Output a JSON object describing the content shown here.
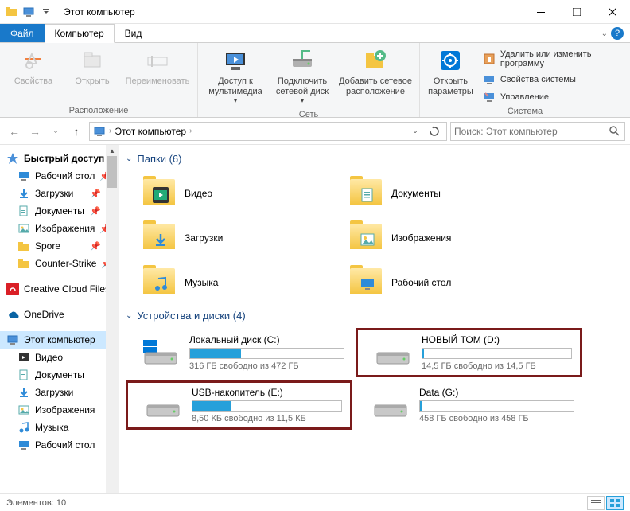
{
  "window": {
    "title": "Этот компьютер"
  },
  "tabs": {
    "file": "Файл",
    "computer": "Компьютер",
    "view": "Вид"
  },
  "ribbon": {
    "location": {
      "group": "Расположение",
      "properties": "Свойства",
      "open": "Открыть",
      "rename": "Переименовать"
    },
    "network": {
      "group": "Сеть",
      "media": "Доступ к мультимедиа",
      "map_drive": "Подключить сетевой диск",
      "add_location": "Добавить сетевое расположение"
    },
    "system": {
      "group": "Система",
      "open_settings": "Открыть параметры",
      "uninstall": "Удалить или изменить программу",
      "sys_props": "Свойства системы",
      "manage": "Управление"
    }
  },
  "nav": {
    "breadcrumb": "Этот компьютер",
    "search_placeholder": "Поиск: Этот компьютер"
  },
  "sidebar": {
    "quick_access": "Быстрый доступ",
    "items_qa": [
      {
        "label": "Рабочий стол",
        "icon": "desktop",
        "pinned": true
      },
      {
        "label": "Загрузки",
        "icon": "downloads",
        "pinned": true
      },
      {
        "label": "Документы",
        "icon": "documents",
        "pinned": true
      },
      {
        "label": "Изображения",
        "icon": "pictures",
        "pinned": true
      },
      {
        "label": "Spore",
        "icon": "folder",
        "pinned": true
      },
      {
        "label": "Counter-Strike",
        "icon": "folder",
        "pinned": true
      }
    ],
    "creative": "Creative Cloud Files",
    "onedrive": "OneDrive",
    "this_pc": "Этот компьютер",
    "items_pc": [
      {
        "label": "Видео",
        "icon": "video"
      },
      {
        "label": "Документы",
        "icon": "documents"
      },
      {
        "label": "Загрузки",
        "icon": "downloads"
      },
      {
        "label": "Изображения",
        "icon": "pictures"
      },
      {
        "label": "Музыка",
        "icon": "music"
      },
      {
        "label": "Рабочий стол",
        "icon": "desktop"
      }
    ]
  },
  "content": {
    "folders_header": "Папки (6)",
    "devices_header": "Устройства и диски (4)",
    "folders": [
      {
        "label": "Видео",
        "icon": "video"
      },
      {
        "label": "Документы",
        "icon": "documents"
      },
      {
        "label": "Загрузки",
        "icon": "downloads"
      },
      {
        "label": "Изображения",
        "icon": "pictures"
      },
      {
        "label": "Музыка",
        "icon": "music"
      },
      {
        "label": "Рабочий стол",
        "icon": "desktop"
      }
    ],
    "drives": [
      {
        "name": "Локальный диск (C:)",
        "free": "316 ГБ свободно из 472 ГБ",
        "fill": 33,
        "highlighted": false,
        "win": true
      },
      {
        "name": "НОВЫЙ ТОМ (D:)",
        "free": "14,5 ГБ свободно из 14,5 ГБ",
        "fill": 1,
        "highlighted": true,
        "win": false
      },
      {
        "name": "USB-накопитель (E:)",
        "free": "8,50 КБ свободно из 11,5 КБ",
        "fill": 26,
        "highlighted": true,
        "win": false
      },
      {
        "name": "Data (G:)",
        "free": "458 ГБ свободно из 458 ГБ",
        "fill": 1,
        "highlighted": false,
        "win": false
      }
    ]
  },
  "status": {
    "elements": "Элементов: 10"
  }
}
